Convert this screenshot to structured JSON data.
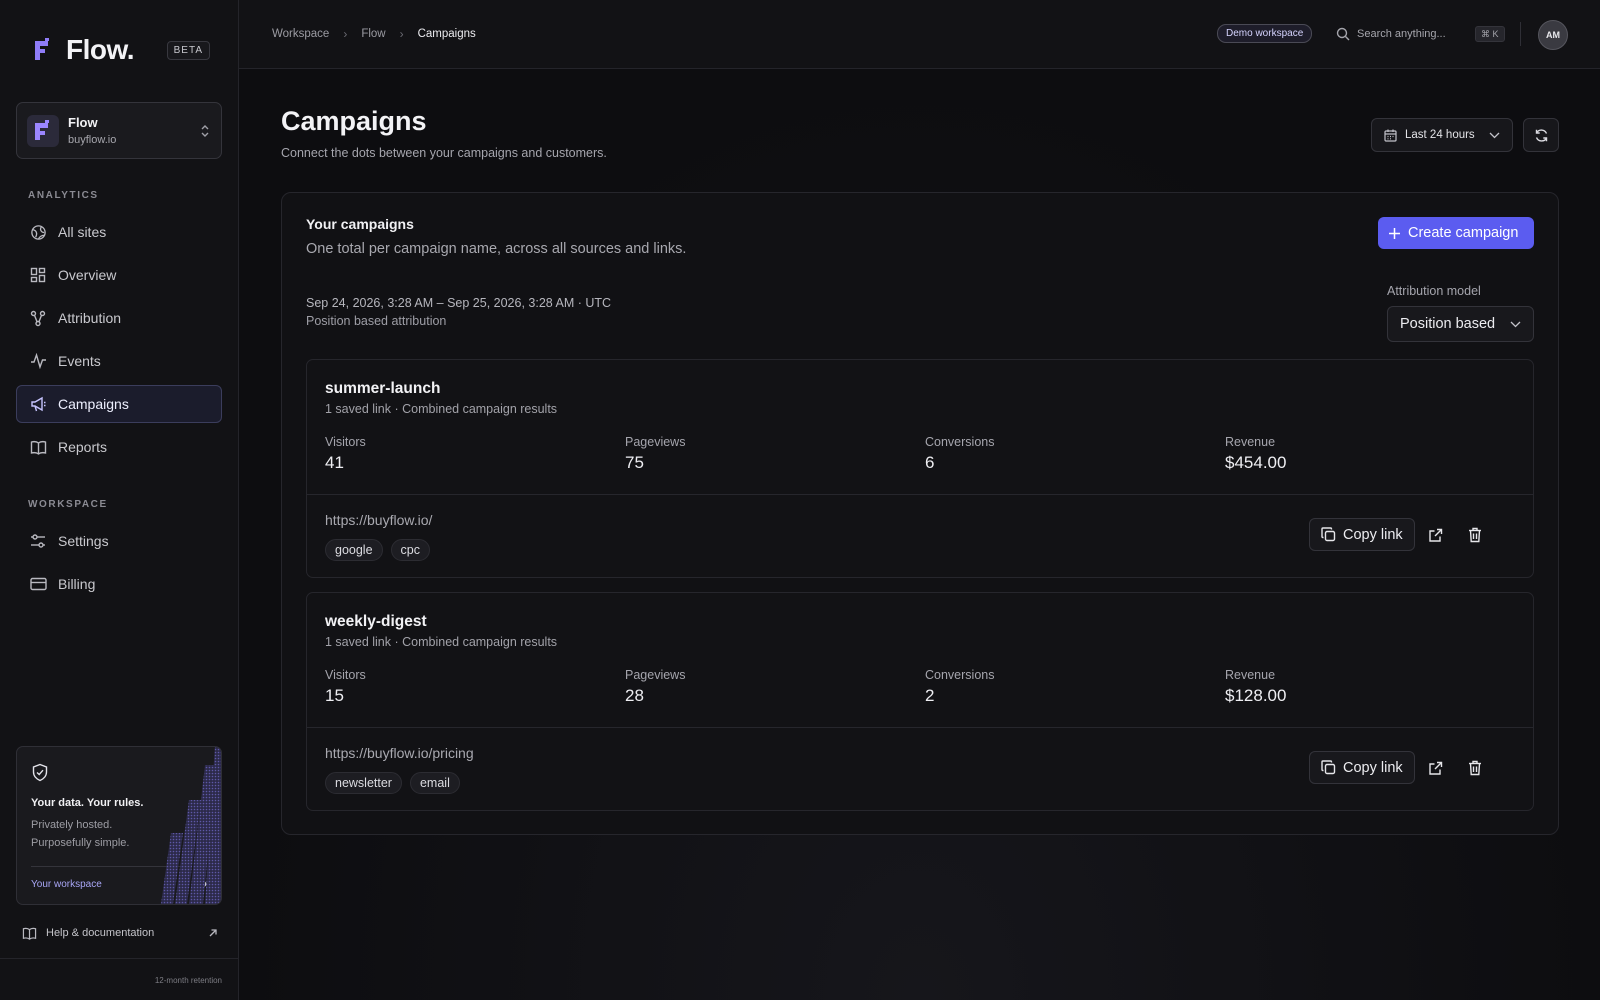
{
  "brand": {
    "name": "Flow.",
    "badge": "BETA",
    "accent": "#5b5cf0"
  },
  "org": {
    "name": "Flow",
    "domain": "buyflow.io"
  },
  "sidebar": {
    "analytics_label": "ANALYTICS",
    "analytics_items": [
      {
        "label": "All sites",
        "icon": "globe-icon"
      },
      {
        "label": "Overview",
        "icon": "dashboard-icon"
      },
      {
        "label": "Attribution",
        "icon": "share-nodes-icon"
      },
      {
        "label": "Events",
        "icon": "activity-icon"
      },
      {
        "label": "Campaigns",
        "icon": "megaphone-icon",
        "active": true
      },
      {
        "label": "Reports",
        "icon": "book-icon"
      }
    ],
    "workspace_label": "WORKSPACE",
    "workspace_items": [
      {
        "label": "Settings",
        "icon": "sliders-icon"
      },
      {
        "label": "Billing",
        "icon": "credit-card-icon"
      }
    ],
    "privacy_card": {
      "title": "Your data. Your rules.",
      "line1": "Privately hosted.",
      "line2": "Purposefully simple.",
      "link": "Your workspace"
    },
    "help": "Help & documentation",
    "retention": "12-month retention"
  },
  "topbar": {
    "breadcrumbs": [
      "Workspace",
      "Flow",
      "Campaigns"
    ],
    "demo_badge": "Demo workspace",
    "search_placeholder": "Search anything...",
    "shortcut": "⌘ K",
    "avatar_initials": "AM"
  },
  "page": {
    "title": "Campaigns",
    "subtitle": "Connect the dots between your campaigns and customers.",
    "range_label": "Last 24 hours"
  },
  "panel": {
    "title": "Your campaigns",
    "subtitle": "One total per campaign name, across all sources and links.",
    "create_label": "Create campaign",
    "date_range": "Sep 24, 2026, 3:28 AM – Sep 25, 2026, 3:28 AM · UTC",
    "attribution_desc": "Position based attribution",
    "attribution_label": "Attribution model",
    "attribution_value": "Position based"
  },
  "campaigns": [
    {
      "name": "summer-launch",
      "meta": "1 saved link · Combined campaign results",
      "metrics": [
        {
          "label": "Visitors",
          "value": "41"
        },
        {
          "label": "Pageviews",
          "value": "75"
        },
        {
          "label": "Conversions",
          "value": "6"
        },
        {
          "label": "Revenue",
          "value": "$454.00"
        }
      ],
      "url": "https://buyflow.io/",
      "tags": [
        "google",
        "cpc"
      ],
      "copy_label": "Copy link"
    },
    {
      "name": "weekly-digest",
      "meta": "1 saved link · Combined campaign results",
      "metrics": [
        {
          "label": "Visitors",
          "value": "15"
        },
        {
          "label": "Pageviews",
          "value": "28"
        },
        {
          "label": "Conversions",
          "value": "2"
        },
        {
          "label": "Revenue",
          "value": "$128.00"
        }
      ],
      "url": "https://buyflow.io/pricing",
      "tags": [
        "newsletter",
        "email"
      ],
      "copy_label": "Copy link"
    }
  ]
}
